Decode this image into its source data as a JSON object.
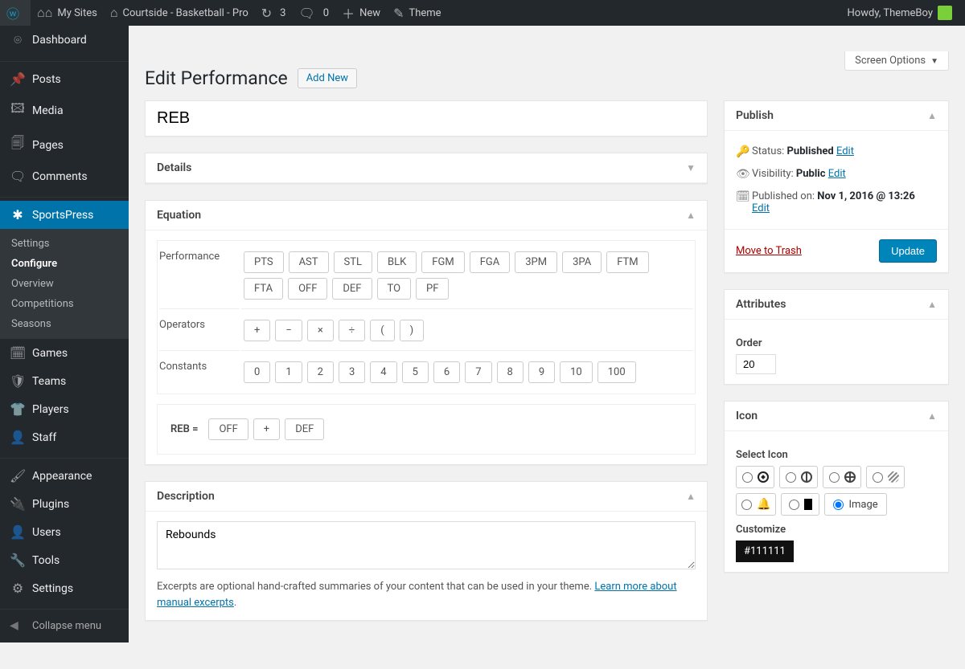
{
  "adminbar": {
    "mysites": "My Sites",
    "sitename": "Courtside - Basketball - Pro",
    "updates": "3",
    "comments": "0",
    "newlabel": "New",
    "themelabel": "Theme",
    "howdy": "Howdy, ThemeBoy"
  },
  "menu": {
    "dashboard": "Dashboard",
    "posts": "Posts",
    "media": "Media",
    "pages": "Pages",
    "comments": "Comments",
    "sportspress": "SportsPress",
    "sp_sub": {
      "settings": "Settings",
      "configure": "Configure",
      "overview": "Overview",
      "competitions": "Competitions",
      "seasons": "Seasons"
    },
    "games": "Games",
    "teams": "Teams",
    "players": "Players",
    "staff": "Staff",
    "appearance": "Appearance",
    "plugins": "Plugins",
    "users": "Users",
    "tools": "Tools",
    "settings": "Settings",
    "collapse": "Collapse menu"
  },
  "screen_options": "Screen Options",
  "page": {
    "title": "Edit Performance",
    "addnew": "Add New",
    "title_value": "REB"
  },
  "panels": {
    "details": "Details",
    "equation": "Equation",
    "description": "Description"
  },
  "equation": {
    "labels": {
      "performance": "Performance",
      "operators": "Operators",
      "constants": "Constants"
    },
    "perf": [
      "PTS",
      "AST",
      "STL",
      "BLK",
      "FGM",
      "FGA",
      "3PM",
      "3PA",
      "FTM",
      "FTA",
      "OFF",
      "DEF",
      "TO",
      "PF"
    ],
    "ops": [
      "+",
      "−",
      "×",
      "÷",
      "(",
      ")"
    ],
    "consts": [
      "0",
      "1",
      "2",
      "3",
      "4",
      "5",
      "6",
      "7",
      "8",
      "9",
      "10",
      "100"
    ],
    "result_label": "REB =",
    "result_tokens": [
      "OFF",
      "+",
      "DEF"
    ]
  },
  "description": {
    "value": "Rebounds",
    "help_a": "Excerpts are optional hand-crafted summaries of your content that can be used in your theme. ",
    "help_link": "Learn more about manual excerpts",
    "help_b": "."
  },
  "publish": {
    "heading": "Publish",
    "status_l": "Status: ",
    "status_v": "Published",
    "edit": "Edit",
    "vis_l": "Visibility: ",
    "vis_v": "Public",
    "pub_l": "Published on: ",
    "pub_v": "Nov 1, 2016 @ 13:26",
    "trash": "Move to Trash",
    "update": "Update"
  },
  "attributes": {
    "heading": "Attributes",
    "order_l": "Order",
    "order_v": "20"
  },
  "iconbox": {
    "heading": "Icon",
    "select": "Select Icon",
    "image_l": "Image",
    "customize": "Customize",
    "color": "#111111"
  }
}
